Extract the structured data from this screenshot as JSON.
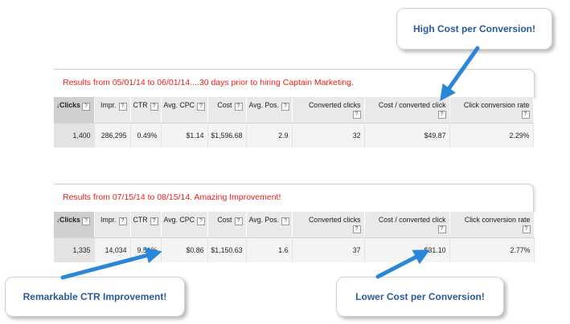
{
  "period1": {
    "title": "Results from 05/01/14 to 06/01/14....30 days prior to hiring Captain Marketing.",
    "columns": [
      "Clicks",
      "Impr.",
      "CTR",
      "Avg. CPC",
      "Cost",
      "Avg. Pos.",
      "Converted clicks",
      "Cost / converted click",
      "Click conversion rate"
    ],
    "help_mark": "?",
    "sort_indicator": "↓",
    "values": [
      "1,400",
      "286,295",
      "0.49%",
      "$1.14",
      "$1,596.68",
      "2.9",
      "32",
      "$49.87",
      "2.29%"
    ]
  },
  "period2": {
    "title": "Results from 07/15/14 to 08/15/14. Amazing Improvement!",
    "columns": [
      "Clicks",
      "Impr.",
      "CTR",
      "Avg. CPC",
      "Cost",
      "Avg. Pos.",
      "Converted clicks",
      "Cost / converted click",
      "Click conversion rate"
    ],
    "help_mark": "?",
    "sort_indicator": "↓",
    "values": [
      "1,335",
      "14,034",
      "9.51%",
      "$0.86",
      "$1,150.63",
      "1.6",
      "37",
      "$31.10",
      "2.77%"
    ]
  },
  "callouts": {
    "high_cost": "High Cost per Conversion!",
    "ctr": "Remarkable CTR Improvement!",
    "lower_cost": "Lower Cost per Conversion!"
  },
  "colors": {
    "title_red": "#e8201a",
    "callout_text": "#2a5a9a",
    "arrow_blue": "#2b86d8"
  }
}
